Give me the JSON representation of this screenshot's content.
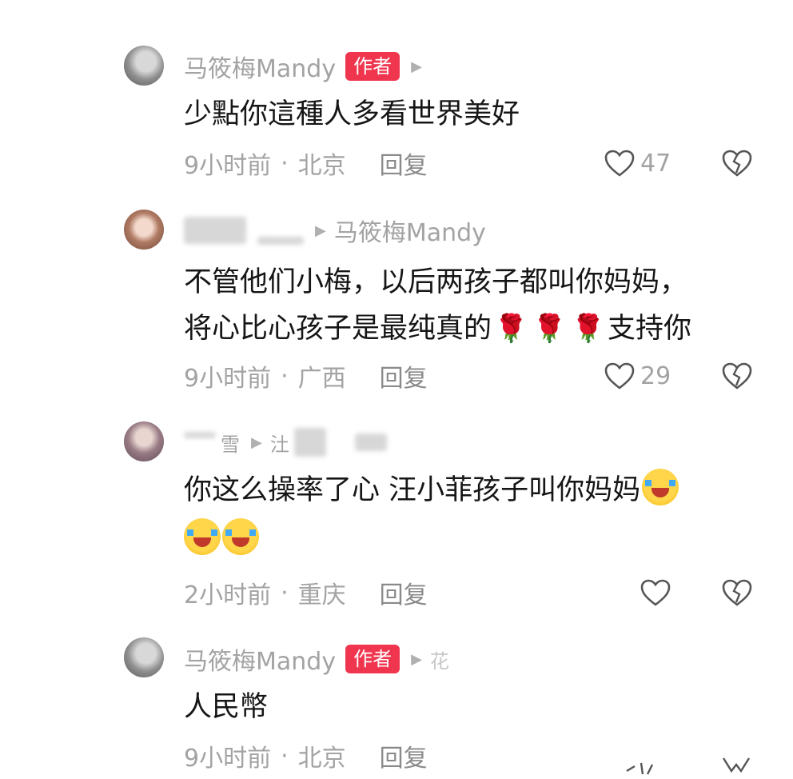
{
  "comments": [
    {
      "username": "马筱梅Mandy",
      "badge": "作者",
      "reply_to": "",
      "text_lines": [
        "少點你這種人多看世界美好"
      ],
      "time": "9小时前",
      "location": "北京",
      "reply_label": "回复",
      "likes": "47"
    },
    {
      "username": "",
      "badge": "",
      "reply_to": "马筱梅Mandy",
      "text_lines": [
        "不管他们小梅，以后两孩子都叫你妈妈，",
        "将心比心孩子是最纯真的",
        "支持你"
      ],
      "time": "9小时前",
      "location": "广西",
      "reply_label": "回复",
      "likes": "29"
    },
    {
      "username": "雪",
      "badge": "",
      "reply_to": "汢",
      "text_lines": [
        "你这么操率了心  汪小菲孩子叫你妈妈"
      ],
      "time": "2小时前",
      "location": "重庆",
      "reply_label": "回复",
      "likes": ""
    },
    {
      "username": "马筱梅Mandy",
      "badge": "作者",
      "reply_to": "花",
      "text_lines": [
        "人民幣"
      ],
      "time": "9小时前",
      "location": "北京",
      "reply_label": "回复",
      "likes": ""
    }
  ],
  "icons": {
    "like": "heart-outline-icon",
    "dislike": "broken-heart-icon",
    "author_badge_color": "#f0364f"
  }
}
